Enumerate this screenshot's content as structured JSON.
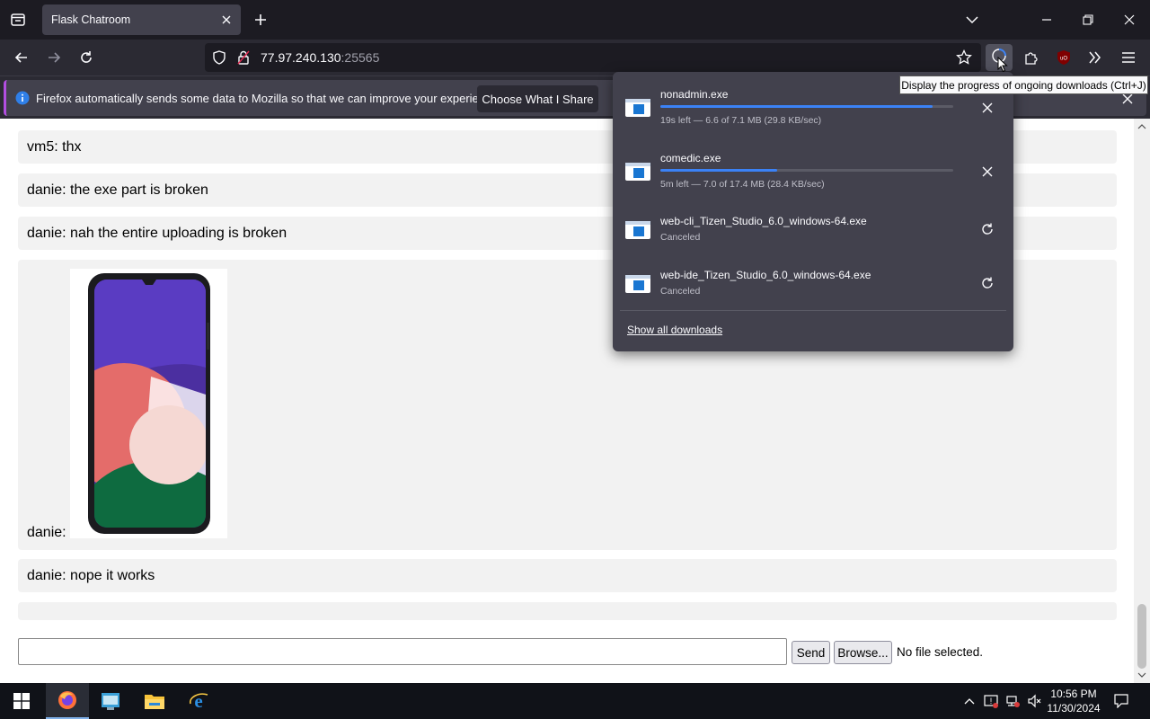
{
  "browser": {
    "tab_title": "Flask Chatroom",
    "url_host": "77.97.240.130",
    "url_port": ":25565",
    "tooltip": "Display the progress of ongoing downloads (Ctrl+J)"
  },
  "notification": {
    "text": "Firefox automatically sends some data to Mozilla so that we can improve your experience.",
    "button_label": "Choose What I Share"
  },
  "chat": {
    "messages": [
      {
        "text": "vm5: thx"
      },
      {
        "text": "danie: the exe part is broken"
      },
      {
        "text": "danie: nah the entire uploading is broken"
      },
      {
        "text": "danie:"
      },
      {
        "text": "danie: nope it works"
      }
    ],
    "input_value": "",
    "send_label": "Send",
    "browse_label": "Browse...",
    "file_status": "No file selected."
  },
  "downloads": {
    "items": [
      {
        "name": "nonadmin.exe",
        "status": "19s left — 6.6 of 7.1 MB (29.8 KB/sec)",
        "progress": 0.93,
        "action": "close-icon"
      },
      {
        "name": "comedic.exe",
        "status": "5m left — 7.0 of 17.4 MB (28.4 KB/sec)",
        "progress": 0.4,
        "action": "close-icon"
      },
      {
        "name": "web-cli_Tizen_Studio_6.0_windows-64.exe",
        "status": "Canceled",
        "action": "retry-icon"
      },
      {
        "name": "web-ide_Tizen_Studio_6.0_windows-64.exe",
        "status": "Canceled",
        "action": "retry-icon"
      }
    ],
    "show_all_label": "Show all downloads"
  },
  "taskbar": {
    "time": "10:56 PM",
    "date": "11/30/2024"
  },
  "colors": {
    "accent": "#3b82f6",
    "chrome_dark": "#1c1b22",
    "panel": "#42414d"
  }
}
